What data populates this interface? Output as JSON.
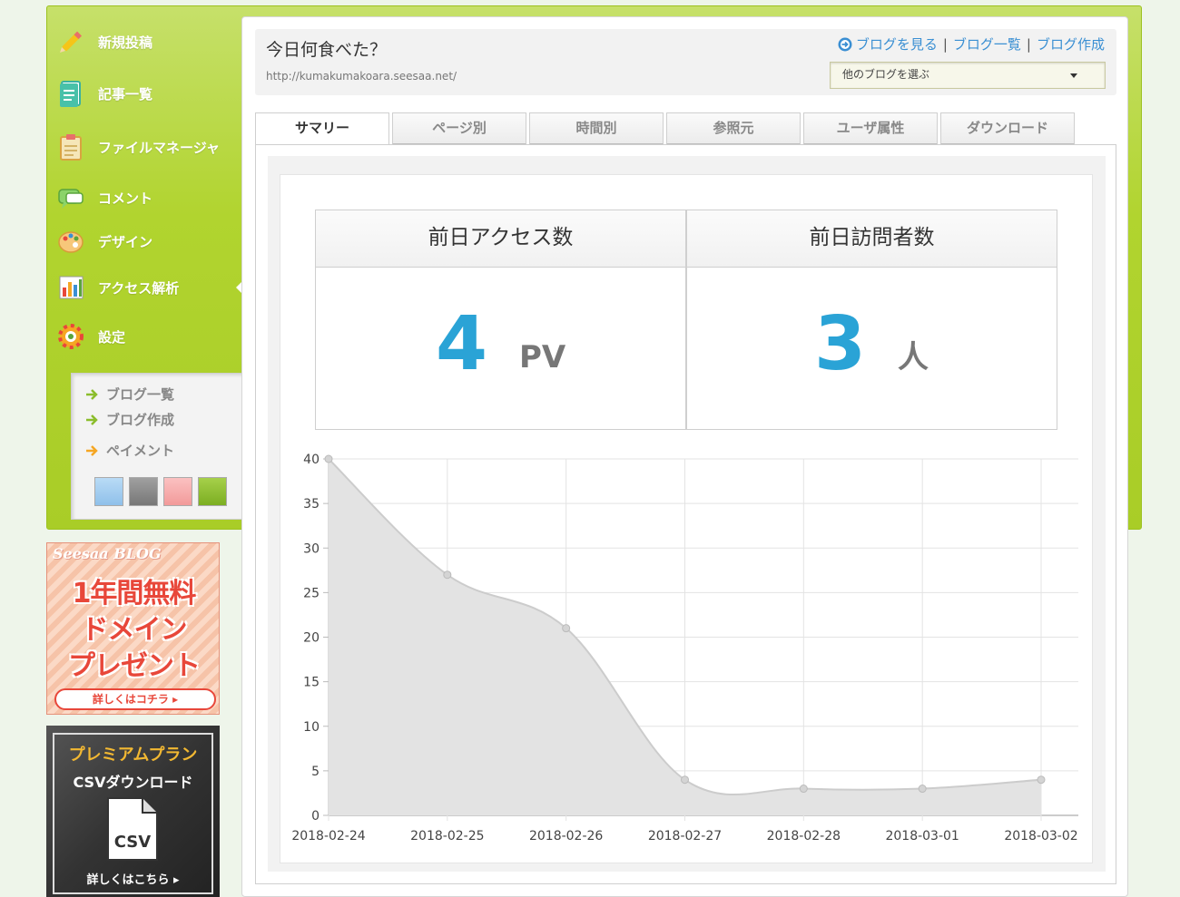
{
  "sidebar": {
    "items": [
      {
        "label": "新規投稿",
        "icon": "pencil-icon"
      },
      {
        "label": "記事一覧",
        "icon": "article-list-icon"
      },
      {
        "label": "ファイルマネージャ",
        "icon": "clipboard-icon"
      },
      {
        "label": "コメント",
        "icon": "comment-icon"
      },
      {
        "label": "デザイン",
        "icon": "palette-icon"
      },
      {
        "label": "アクセス解析",
        "icon": "bar-chart-icon"
      },
      {
        "label": "設定",
        "icon": "gear-icon"
      }
    ],
    "active_index": 5,
    "sub_links": [
      "ブログ一覧",
      "ブログ作成",
      "ペイメント"
    ],
    "swatches": [
      "#9cc8ee",
      "#8c8c8c",
      "#f5a8a8",
      "#8bbd2c"
    ]
  },
  "banners": {
    "domain": {
      "brand": "Seesaa BLOG",
      "lines": [
        "1年間無料",
        "ドメイン",
        "プレゼント"
      ],
      "button": "詳しくはコチラ ▸"
    },
    "premium": {
      "title": "プレミアムプラン",
      "subtitle": "CSVダウンロード",
      "file_label": "CSV",
      "button": "詳しくはこちら ▸"
    }
  },
  "header": {
    "title": "今日何食べた？",
    "url": "http://kumakumakoara.seesaa.net/",
    "links": [
      "ブログを見る",
      "ブログ一覧",
      "ブログ作成"
    ],
    "select_value": "他のブログを選ぶ"
  },
  "tabs": [
    "サマリー",
    "ページ別",
    "時間別",
    "参照元",
    "ユーザ属性",
    "ダウンロード"
  ],
  "active_tab": 0,
  "stats": [
    {
      "label": "前日アクセス数",
      "value": "4",
      "unit": "PV"
    },
    {
      "label": "前日訪問者数",
      "value": "3",
      "unit": "人"
    }
  ],
  "colors": {
    "accent_green": "#b1d42f",
    "number_blue": "#2aa3d6",
    "link_blue": "#3a8fd3"
  },
  "chart_data": {
    "type": "area",
    "x": [
      "2018-02-24",
      "2018-02-25",
      "2018-02-26",
      "2018-02-27",
      "2018-02-28",
      "2018-03-01",
      "2018-03-02"
    ],
    "series": [
      {
        "values": [
          40,
          27,
          21,
          4,
          3,
          3,
          4
        ]
      }
    ],
    "ylim": [
      0,
      40
    ],
    "yticks": [
      0,
      5,
      10,
      15,
      20,
      25,
      30,
      35,
      40
    ],
    "grid": true,
    "fill_color": "#e3e3e3",
    "line_color": "#cccccc"
  }
}
